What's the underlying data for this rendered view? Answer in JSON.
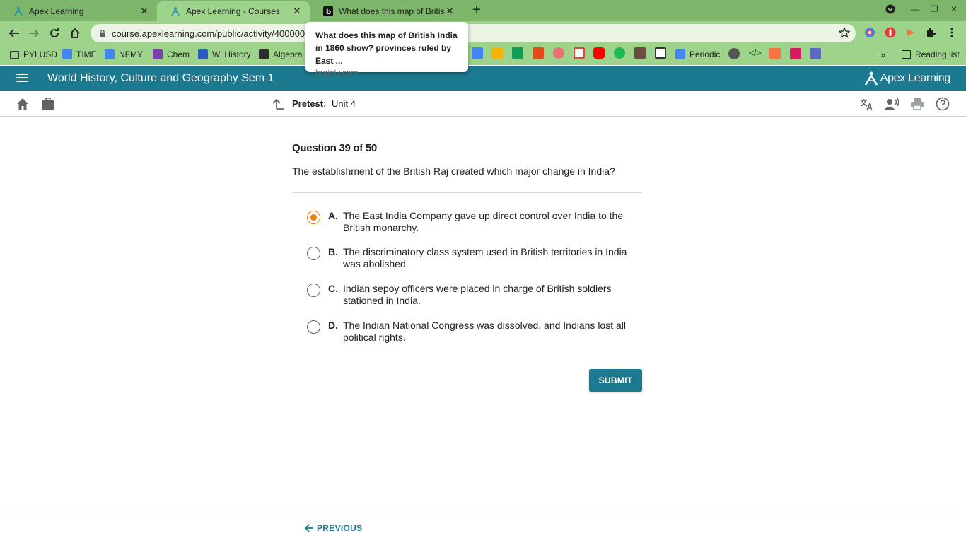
{
  "browser": {
    "tabs": [
      {
        "title": "Apex Learning",
        "active": false
      },
      {
        "title": "Apex Learning - Courses",
        "active": true
      },
      {
        "title": "What does this map of British India",
        "active": false
      }
    ],
    "url": "course.apexlearning.com/public/activity/400000",
    "bookmarks": [
      "PYLUSD",
      "TIME",
      "NFMY",
      "Chem",
      "W. History",
      "Algebra 2"
    ],
    "bookmark_periodic": "Periodic",
    "reading_list": "Reading list",
    "tooltip": {
      "title": "What does this map of British India in 1860 show? provinces ruled by East ...",
      "domain": "brainly.com"
    }
  },
  "app": {
    "course_title": "World History, Culture and Geography Sem 1",
    "logo_text": "Apex Learning",
    "pretest_label": "Pretest:",
    "pretest_value": "Unit 4",
    "brand_color": "#1b7a90",
    "accent_color": "#e8820c"
  },
  "question": {
    "number_label": "Question 39 of 50",
    "text": "The establishment of the British Raj created which major change in India?",
    "options": [
      {
        "letter": "A.",
        "text": "The East India Company gave up direct control over India to the British monarchy.",
        "selected": true
      },
      {
        "letter": "B.",
        "text": "The discriminatory class system used in British territories in India was abolished.",
        "selected": false
      },
      {
        "letter": "C.",
        "text": "Indian sepoy officers were placed in charge of British soldiers stationed in India.",
        "selected": false
      },
      {
        "letter": "D.",
        "text": "The Indian National Congress was dissolved, and Indians lost all political rights.",
        "selected": false
      }
    ],
    "submit_label": "SUBMIT",
    "previous_label": "PREVIOUS"
  },
  "icons": [
    "back-icon",
    "forward-icon",
    "reload-icon",
    "home-icon",
    "star-icon",
    "extensions-icon",
    "menu-icon",
    "briefcase-icon",
    "up-arrow-icon",
    "translate-icon",
    "read-aloud-icon",
    "print-icon",
    "help-icon"
  ]
}
